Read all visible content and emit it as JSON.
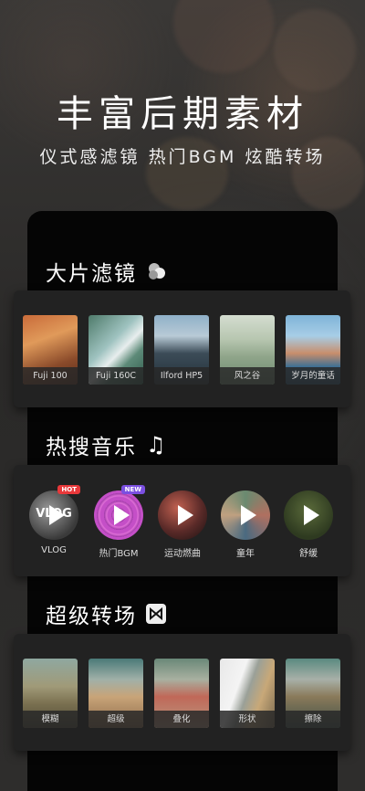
{
  "hero": {
    "title": "丰富后期素材",
    "subtitle": "仪式感滤镜 热门BGM 炫酷转场"
  },
  "filters": {
    "title": "大片滤镜",
    "icon": "overlap-circles-icon",
    "items": [
      {
        "label": "Fuji 100"
      },
      {
        "label": "Fuji 160C"
      },
      {
        "label": "Ilford HP5"
      },
      {
        "label": "风之谷"
      },
      {
        "label": "岁月的童话"
      }
    ]
  },
  "music": {
    "title": "热搜音乐",
    "icon": "music-note-icon",
    "items": [
      {
        "label": "VLOG",
        "badge": "HOT",
        "disc_text": "VLOG"
      },
      {
        "label": "热门BGM",
        "badge": "NEW"
      },
      {
        "label": "运动燃曲"
      },
      {
        "label": "童年"
      },
      {
        "label": "舒缓"
      }
    ]
  },
  "transitions": {
    "title": "超级转场",
    "icon": "bowtie-icon",
    "items": [
      {
        "label": "模糊"
      },
      {
        "label": "超级"
      },
      {
        "label": "叠化"
      },
      {
        "label": "形状"
      },
      {
        "label": "擦除"
      }
    ]
  },
  "colors": {
    "hot": "#e8383a",
    "new": "#7b4fe0"
  }
}
